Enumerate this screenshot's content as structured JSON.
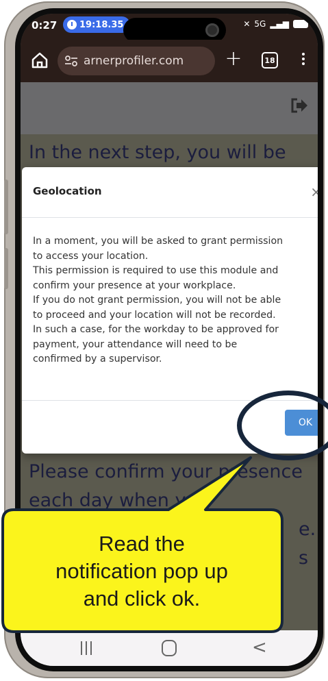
{
  "status_bar": {
    "time": "0:27",
    "timer": "19:18.35",
    "extra": "✦ •",
    "network": "5G"
  },
  "browser": {
    "url": "arnerprofiler.com",
    "tab_count": "18"
  },
  "page": {
    "line_1": "In the next step, you will be",
    "line_2": "Please confirm your presence",
    "line_3": "each day when you",
    "line_4_end": "e.",
    "line_5_end": "s"
  },
  "modal": {
    "title": "Geolocation",
    "close": "×",
    "body_lines": [
      "In a moment, you will be asked to grant permission",
      "to access your location.",
      "This permission is required to use this module and",
      "confirm your presence at your workplace.",
      "If you do not grant permission, you will not be able",
      "to proceed and your location will not be recorded.",
      "In such a case, for the workday to be approved for",
      "payment, your attendance will need to be",
      "confirmed by a supervisor."
    ],
    "ok_label": "OK"
  },
  "callout": {
    "line_1": "Read the",
    "line_2": "notification pop up",
    "line_3": "and click ok.",
    "fill": "#fbf41c",
    "border": "#17263b"
  },
  "colors": {
    "browser_bg": "#2a1d19",
    "page_bg": "#5b5a4e",
    "ok_button": "#4c8ed6"
  }
}
